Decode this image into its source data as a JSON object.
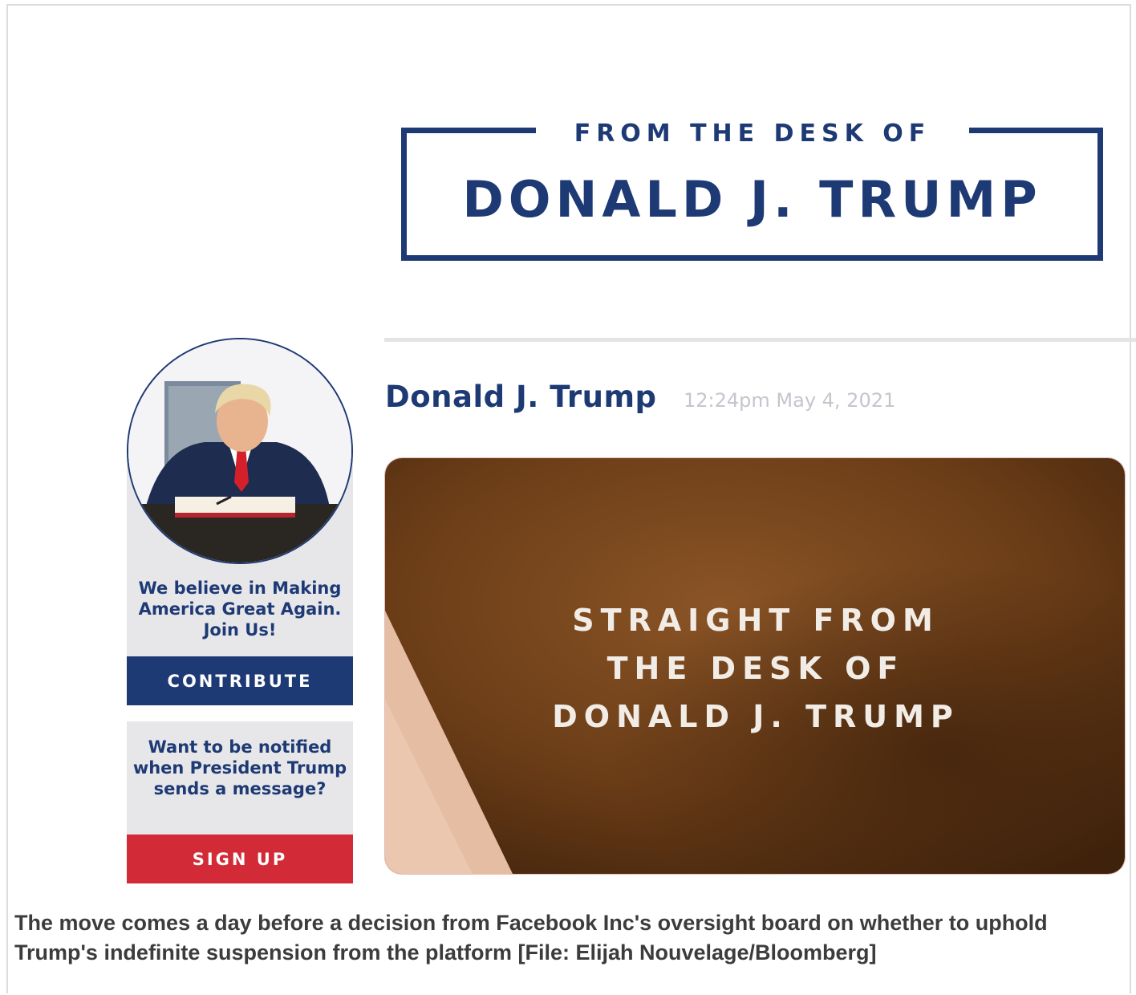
{
  "masthead": {
    "small_line": "FROM THE DESK OF",
    "big_line": "DONALD J. TRUMP"
  },
  "sidebar": {
    "join_text": "We believe in Making America Great Again. Join Us!",
    "contribute_label": "CONTRIBUTE",
    "notify_text": "Want to be notified when President Trump sends a message?",
    "signup_label": "SIGN UP"
  },
  "post": {
    "author": "Donald J. Trump",
    "timestamp": "12:24pm May 4, 2021",
    "image_lines": [
      "STRAIGHT FROM",
      "THE DESK OF",
      "DONALD J. TRUMP"
    ]
  },
  "caption": "The move comes a day before a decision from Facebook Inc's oversight board on whether to uphold Trump's indefinite suspension from the platform [File: Elijah Nouvelage/Bloomberg]",
  "colors": {
    "navy": "#1e3a74",
    "red": "#d22a36",
    "card_gray": "#e7e7ea",
    "leather": "#6b3d17"
  }
}
